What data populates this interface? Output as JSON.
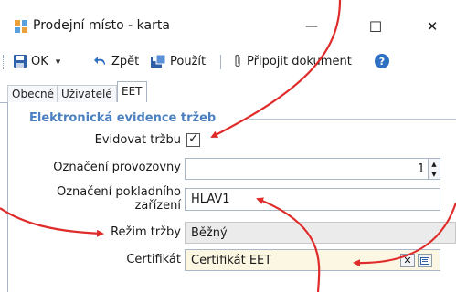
{
  "window": {
    "title": "Prodejní místo - karta",
    "controls": [
      "—",
      "☐",
      "✕"
    ]
  },
  "toolbar": {
    "ok_label": "OK",
    "ok_dropdown": "▾",
    "back_label": "Zpět",
    "apply_label": "Použít",
    "attach_label": "Připojit dokument",
    "help_glyph": "?"
  },
  "tabs": [
    {
      "label": "Obecné"
    },
    {
      "label": "Uživatelé"
    },
    {
      "label": "EET",
      "active": true
    }
  ],
  "group": {
    "title": "Elektronická evidence tržeb"
  },
  "fields": {
    "evidovat": {
      "label": "Evidovat tržbu",
      "checked": true,
      "check_glyph": "✓"
    },
    "provozovna": {
      "label": "Označení provozovny",
      "value": "1"
    },
    "pokladna": {
      "label_line1": "Označení pokladního",
      "label_line2": "zařízení",
      "value": "HLAV1"
    },
    "rezim": {
      "label": "Režim tržby",
      "value": "Běžný"
    },
    "certifikat": {
      "label": "Certifikát",
      "value": "Certifikát EET",
      "clear_glyph": "✕"
    }
  },
  "colors": {
    "accent": "#4a7fc0",
    "disabled_field": "#ebebeb",
    "highlight_field": "#fbf7e3",
    "annotation_red": "#e02b2b"
  }
}
